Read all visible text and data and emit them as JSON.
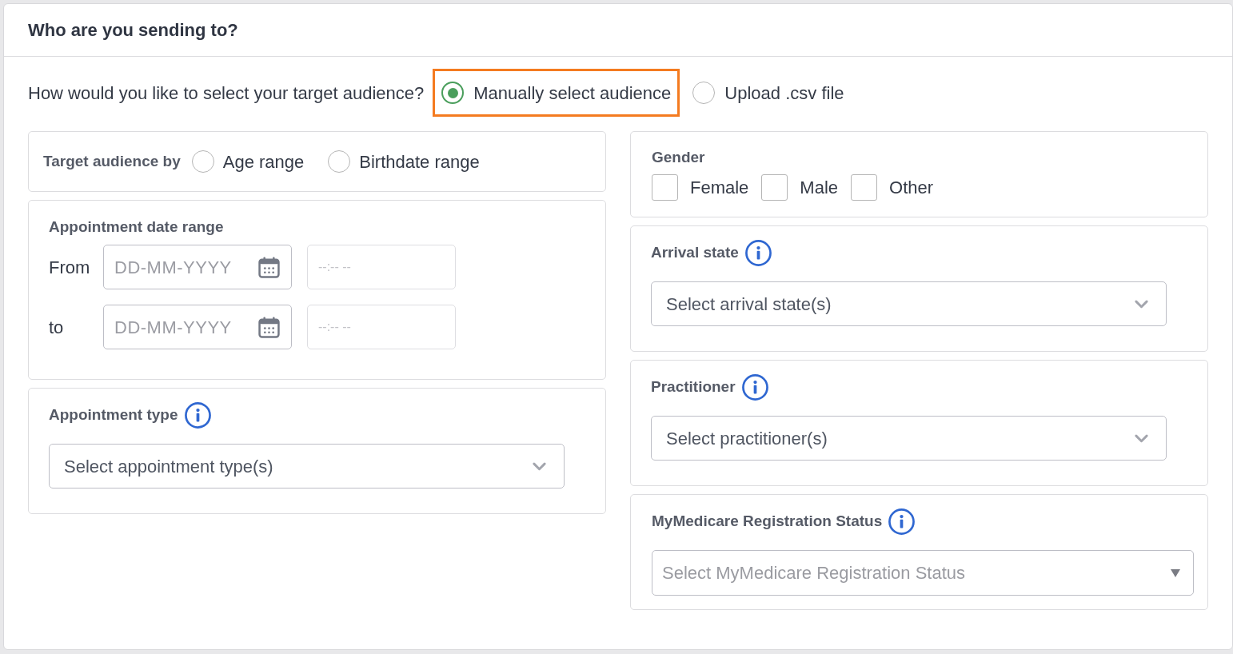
{
  "header": {
    "title": "Who are you sending to?"
  },
  "audience_source": {
    "question": "How would you like to select your target audience?",
    "options": [
      {
        "label": "Manually select audience",
        "selected": true,
        "highlighted": true
      },
      {
        "label": "Upload .csv file",
        "selected": false,
        "highlighted": false
      }
    ]
  },
  "columns": [
    {
      "panels": [
        {
          "kind": "radio_group",
          "title": "Target audience by",
          "info": false,
          "options": [
            {
              "label": "Age range",
              "selected": false
            },
            {
              "label": "Birthdate range",
              "selected": false
            }
          ]
        },
        {
          "kind": "date_range",
          "title": "Appointment date range",
          "info": false,
          "rows": [
            {
              "label": "From",
              "date_placeholder": "DD-MM-YYYY",
              "time_placeholder": "--:-- --",
              "time_disabled": true
            },
            {
              "label": "to",
              "date_placeholder": "DD-MM-YYYY",
              "time_placeholder": "--:-- --",
              "time_disabled": true
            }
          ]
        },
        {
          "kind": "multi_select",
          "title": "Appointment type",
          "info": true,
          "placeholder": "Select appointment type(s)"
        }
      ]
    },
    {
      "panels": [
        {
          "kind": "checkbox_group",
          "title": "Gender",
          "info": false,
          "options": [
            {
              "label": "Female",
              "checked": false
            },
            {
              "label": "Male",
              "checked": false
            },
            {
              "label": "Other",
              "checked": false
            }
          ]
        },
        {
          "kind": "multi_select",
          "title": "Arrival state",
          "info": true,
          "placeholder": "Select arrival state(s)"
        },
        {
          "kind": "multi_select",
          "title": "Practitioner",
          "info": true,
          "placeholder": "Select practitioner(s)"
        },
        {
          "kind": "select",
          "title": "MyMedicare Registration Status",
          "info": true,
          "placeholder": "Select MyMedicare Registration Status"
        }
      ]
    }
  ]
}
